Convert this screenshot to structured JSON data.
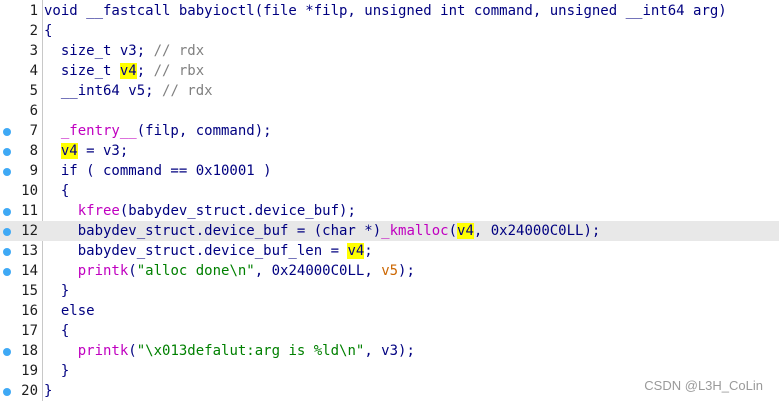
{
  "editor": {
    "current_line": 12,
    "lines": [
      {
        "num": "1",
        "bp": false,
        "tokens": [
          {
            "t": "void __fastcall babyioctl(file *filp, unsigned int command, unsigned __int64 arg)",
            "c": "plain"
          }
        ]
      },
      {
        "num": "2",
        "bp": false,
        "tokens": [
          {
            "t": "{",
            "c": "plain"
          }
        ]
      },
      {
        "num": "3",
        "bp": false,
        "tokens": [
          {
            "t": "  size_t v3; ",
            "c": "plain"
          },
          {
            "t": "// rdx",
            "c": "comment"
          }
        ]
      },
      {
        "num": "4",
        "bp": false,
        "tokens": [
          {
            "t": "  size_t ",
            "c": "plain"
          },
          {
            "t": "v4",
            "c": "hl"
          },
          {
            "t": "; ",
            "c": "plain"
          },
          {
            "t": "// rbx",
            "c": "comment"
          }
        ]
      },
      {
        "num": "5",
        "bp": false,
        "tokens": [
          {
            "t": "  __int64 v5; ",
            "c": "plain"
          },
          {
            "t": "// rdx",
            "c": "comment"
          }
        ]
      },
      {
        "num": "6",
        "bp": false,
        "tokens": [
          {
            "t": "",
            "c": "plain"
          }
        ]
      },
      {
        "num": "7",
        "bp": true,
        "tokens": [
          {
            "t": "  ",
            "c": "plain"
          },
          {
            "t": "_fentry__",
            "c": "func"
          },
          {
            "t": "(filp, command);",
            "c": "plain"
          }
        ]
      },
      {
        "num": "8",
        "bp": true,
        "tokens": [
          {
            "t": "  ",
            "c": "plain"
          },
          {
            "t": "v4",
            "c": "hl"
          },
          {
            "t": " = v3;",
            "c": "plain"
          }
        ]
      },
      {
        "num": "9",
        "bp": true,
        "tokens": [
          {
            "t": "  if ( command == 0x10001 )",
            "c": "plain"
          }
        ]
      },
      {
        "num": "10",
        "bp": false,
        "tokens": [
          {
            "t": "  {",
            "c": "plain"
          }
        ]
      },
      {
        "num": "11",
        "bp": true,
        "tokens": [
          {
            "t": "    ",
            "c": "plain"
          },
          {
            "t": "kfree",
            "c": "func"
          },
          {
            "t": "(babydev_struct.device_buf);",
            "c": "plain"
          }
        ]
      },
      {
        "num": "12",
        "bp": true,
        "tokens": [
          {
            "t": "    babydev_struct.device_buf = (char *)",
            "c": "plain"
          },
          {
            "t": "_kmalloc",
            "c": "func"
          },
          {
            "t": "(",
            "c": "plain"
          },
          {
            "t": "v4",
            "c": "hl"
          },
          {
            "t": ", 0x24000C0LL);",
            "c": "plain"
          }
        ]
      },
      {
        "num": "13",
        "bp": true,
        "tokens": [
          {
            "t": "    babydev_struct.device_buf_len = ",
            "c": "plain"
          },
          {
            "t": "v4",
            "c": "hl"
          },
          {
            "t": ";",
            "c": "plain"
          }
        ]
      },
      {
        "num": "14",
        "bp": true,
        "tokens": [
          {
            "t": "    ",
            "c": "plain"
          },
          {
            "t": "printk",
            "c": "func"
          },
          {
            "t": "(",
            "c": "plain"
          },
          {
            "t": "\"alloc done\\n\"",
            "c": "str"
          },
          {
            "t": ", 0x24000C0LL, ",
            "c": "plain"
          },
          {
            "t": "v5",
            "c": "arg"
          },
          {
            "t": ");",
            "c": "plain"
          }
        ]
      },
      {
        "num": "15",
        "bp": false,
        "tokens": [
          {
            "t": "  }",
            "c": "plain"
          }
        ]
      },
      {
        "num": "16",
        "bp": false,
        "tokens": [
          {
            "t": "  else",
            "c": "plain"
          }
        ]
      },
      {
        "num": "17",
        "bp": false,
        "tokens": [
          {
            "t": "  {",
            "c": "plain"
          }
        ]
      },
      {
        "num": "18",
        "bp": true,
        "tokens": [
          {
            "t": "    ",
            "c": "plain"
          },
          {
            "t": "printk",
            "c": "func"
          },
          {
            "t": "(",
            "c": "plain"
          },
          {
            "t": "\"\\x013defalut:arg is %ld\\n\"",
            "c": "str"
          },
          {
            "t": ", v3);",
            "c": "plain"
          }
        ]
      },
      {
        "num": "19",
        "bp": false,
        "tokens": [
          {
            "t": "  }",
            "c": "plain"
          }
        ]
      },
      {
        "num": "20",
        "bp": true,
        "tokens": [
          {
            "t": "}",
            "c": "plain"
          }
        ]
      }
    ]
  },
  "watermark": "CSDN @L3H_CoLin",
  "colors": {
    "breakpoint": "#3fa9f5",
    "highlight": "#ffff00",
    "function": "#c000c0",
    "string": "#008000",
    "comment": "#808080",
    "code": "#000080"
  }
}
